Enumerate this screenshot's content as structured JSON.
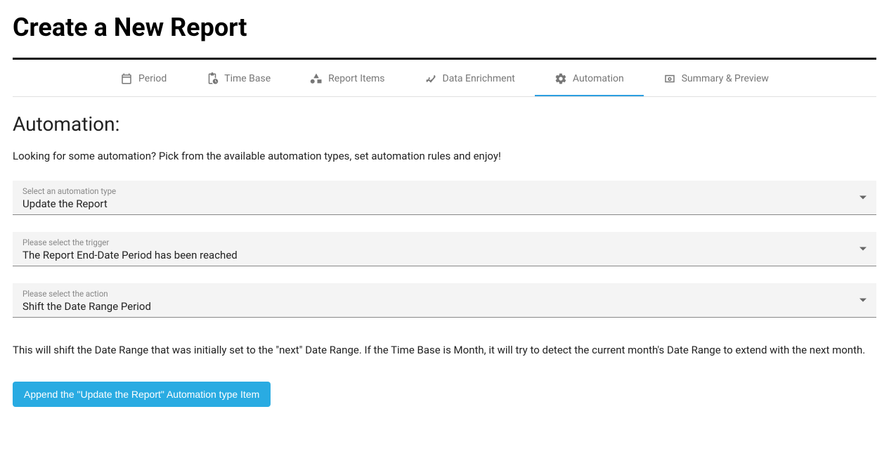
{
  "page": {
    "title": "Create a New Report"
  },
  "tabs": [
    {
      "label": "Period"
    },
    {
      "label": "Time Base"
    },
    {
      "label": "Report Items"
    },
    {
      "label": "Data Enrichment"
    },
    {
      "label": "Automation"
    },
    {
      "label": "Summary & Preview"
    }
  ],
  "section": {
    "title": "Automation:",
    "intro": "Looking for some automation? Pick from the available automation types, set automation rules and enjoy!"
  },
  "fields": {
    "automation_type": {
      "label": "Select an automation type",
      "value": "Update the Report"
    },
    "trigger": {
      "label": "Please select the trigger",
      "value": "The Report End-Date Period has been reached"
    },
    "action": {
      "label": "Please select the action",
      "value": "Shift the Date Range Period"
    }
  },
  "description": "This will shift the Date Range that was initially set to the \"next\" Date Range. If the Time Base is Month, it will try to detect the current month's Date Range to extend with the next month.",
  "buttons": {
    "append": "Append the \"Update the Report\" Automation type Item"
  }
}
